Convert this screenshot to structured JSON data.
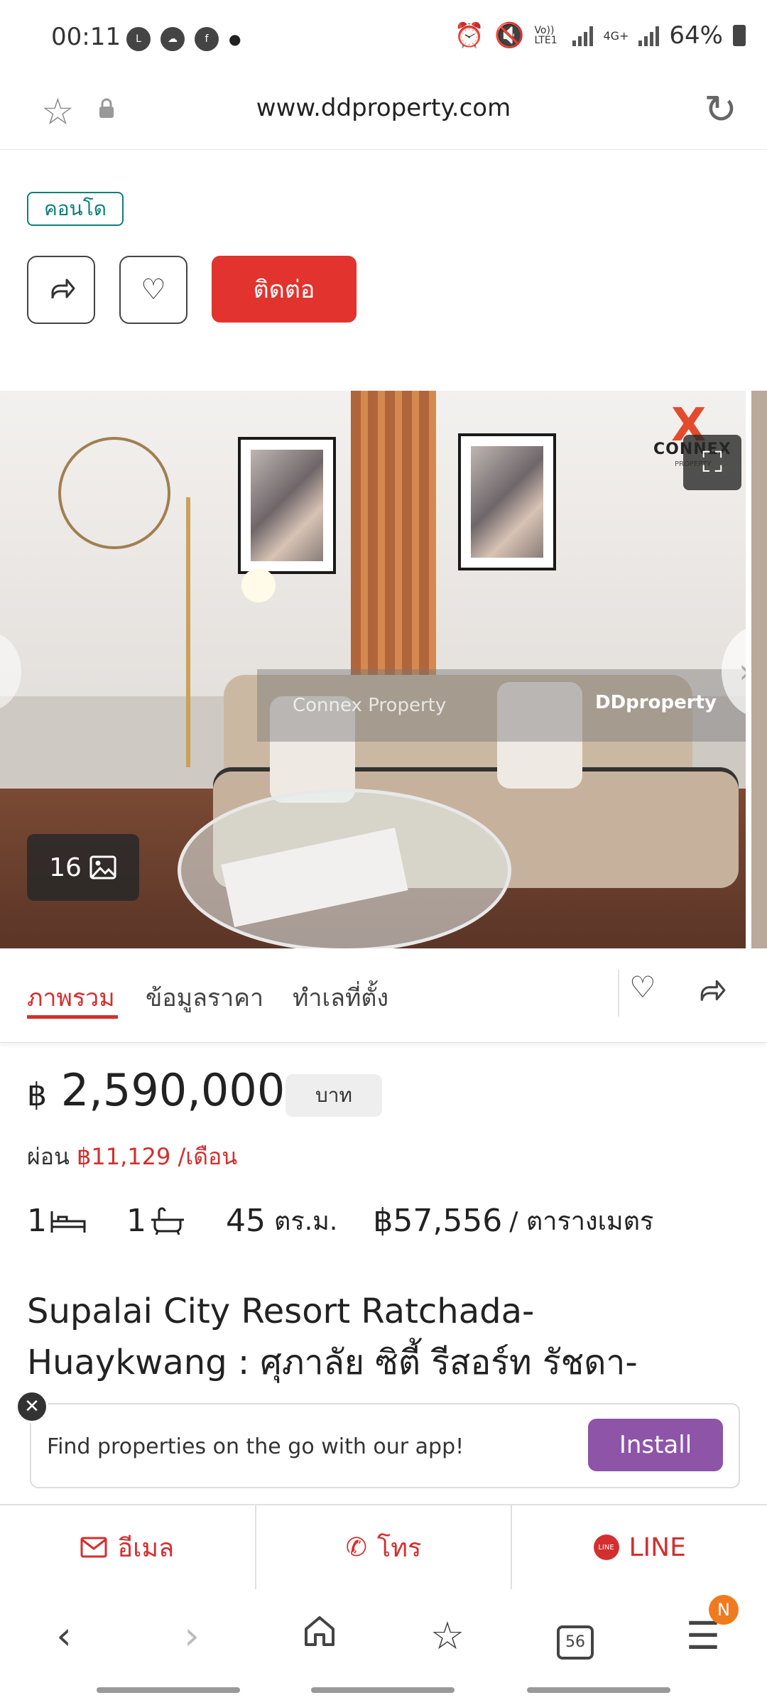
{
  "status_bar": {
    "time": "00:11",
    "battery": "64%",
    "network": "4G+",
    "volte": "Vo)) LTE1"
  },
  "browser": {
    "url": "www.ddproperty.com"
  },
  "listing": {
    "type_tag": "คอนโด",
    "contact_label": "ติดต่อ",
    "photo_count": "16",
    "watermark_agent": "Connex Property",
    "watermark_brand": "DDproperty",
    "logo_text": "CONNEX",
    "logo_sub": "PROPERTY",
    "tabs": [
      "ภาพรวม",
      "ข้อมูลราคา",
      "ทำเลที่ตั้ง"
    ],
    "currency_symbol": "฿",
    "price": "2,590,000",
    "price_unit": "บาท",
    "installment_label": "ผ่อน",
    "installment_amount": "฿11,129 /เดือน",
    "bedrooms": "1",
    "bathrooms": "1",
    "area_value": "45",
    "area_unit": "ตร.ม.",
    "price_per_sqm": "฿57,556",
    "price_per_sqm_unit": "/ ตารางเมตร",
    "title_line1": "Supalai City Resort Ratchada-",
    "title_line2": "Huaykwang : ศุภาลัย ซิตี้ รีสอร์ท รัชดา-"
  },
  "app_banner": {
    "text": "Find properties on the go with our app!",
    "install_label": "Install"
  },
  "contact_bar": {
    "email": "อีเมล",
    "call": "โทร",
    "line": "LINE"
  },
  "bottom_nav": {
    "tabs_count": "56",
    "notification": "N"
  },
  "colors": {
    "accent_red": "#d32f2f",
    "contact_red": "#e2332e",
    "teal_tag": "#0e7f7a",
    "install_purple": "#8e54a8"
  }
}
